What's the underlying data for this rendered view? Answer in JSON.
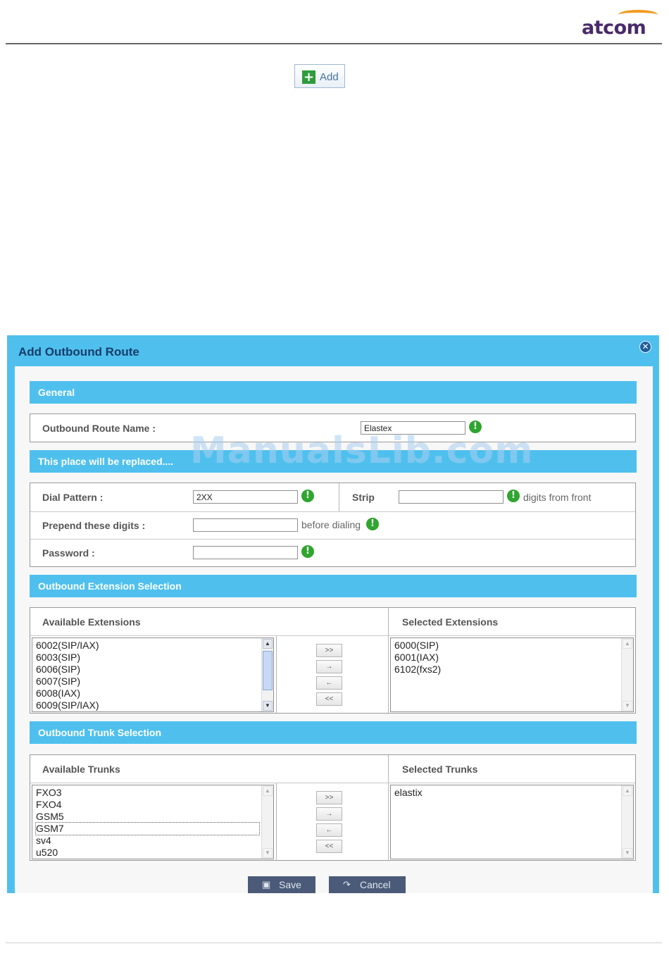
{
  "brand": {
    "logo_text": "atcom"
  },
  "add_button": {
    "label": "Add",
    "icon": "plus-icon"
  },
  "dialog": {
    "title": "Add Outbound Route",
    "close_icon": "close-icon",
    "sections": {
      "general": "General",
      "replaced": "This place will be replaced....",
      "extensions": "Outbound Extension Selection",
      "trunks": "Outbound Trunk Selection"
    },
    "general": {
      "route_name_label": "Outbound Route Name :",
      "route_name_value": "Elastex"
    },
    "dial": {
      "dial_pattern_label": "Dial Pattern :",
      "dial_pattern_value": "2XX",
      "strip_label": "Strip",
      "strip_value": "",
      "strip_suffix": "digits from front",
      "prepend_label": "Prepend these digits :",
      "prepend_value": "",
      "prepend_suffix": "before dialing",
      "password_label": "Password :",
      "password_value": ""
    },
    "extensions": {
      "available_header": "Available Extensions",
      "selected_header": "Selected Extensions",
      "available": [
        "6002(SIP/IAX)",
        "6003(SIP)",
        "6006(SIP)",
        "6007(SIP)",
        "6008(IAX)",
        "6009(SIP/IAX)"
      ],
      "selected": [
        "6000(SIP)",
        "6001(IAX)",
        "6102(fxs2)"
      ]
    },
    "trunks": {
      "available_header": "Available Trunks",
      "selected_header": "Selected Trunks",
      "available": [
        "FXO3",
        "FXO4",
        "GSM5",
        "GSM7",
        "sv4",
        "u520"
      ],
      "selected": [
        "elastix"
      ]
    },
    "move_buttons": {
      "add_all": ">>",
      "add": "→",
      "remove": "←",
      "remove_all": "<<"
    },
    "save_label": "Save",
    "cancel_label": "Cancel"
  },
  "watermark": "ManualsLib.com"
}
